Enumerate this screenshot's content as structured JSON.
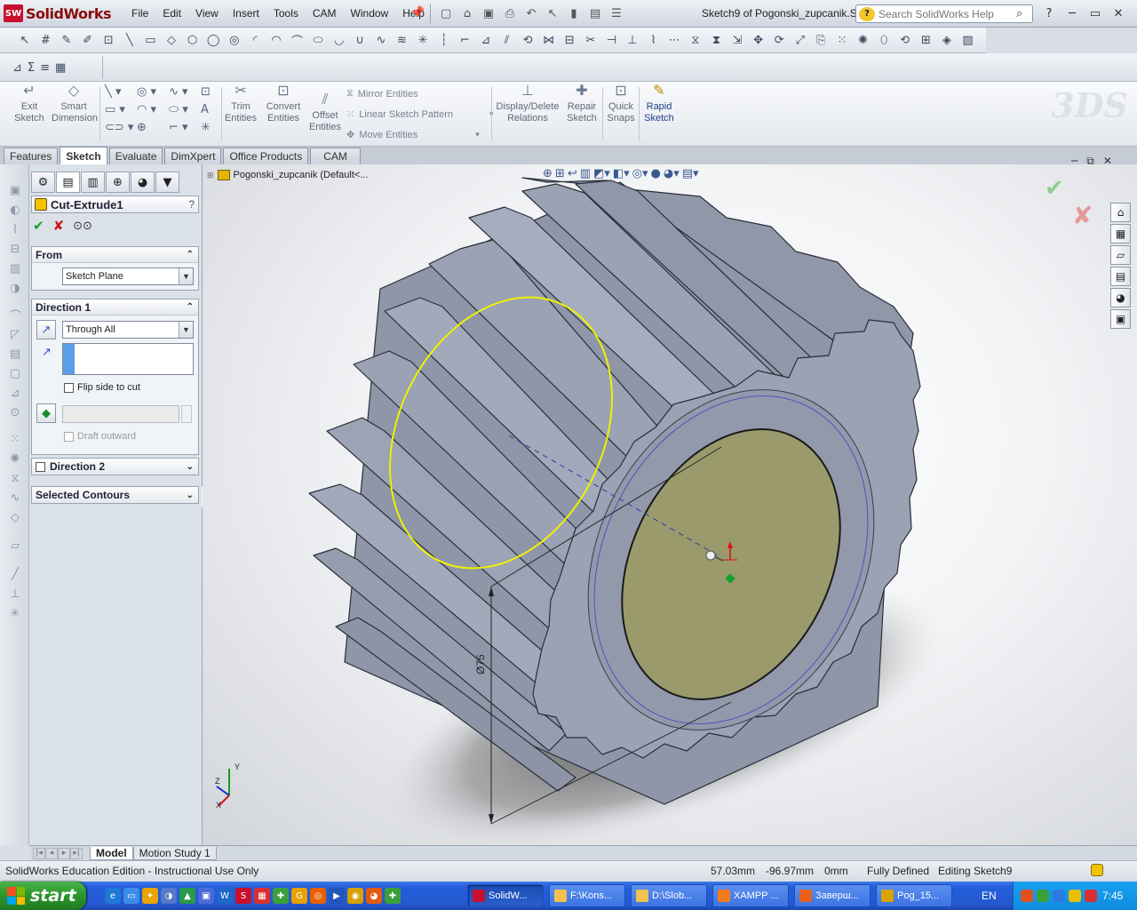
{
  "app": {
    "name": "SolidWorks",
    "logo_badge": "SW",
    "document_title": "Sketch9 of Pogonski_zupcanik.S...",
    "menus": [
      "File",
      "Edit",
      "View",
      "Insert",
      "Tools",
      "CAM",
      "Window",
      "Help"
    ],
    "help_search_placeholder": "Search SolidWorks Help",
    "help_glyph": "?"
  },
  "command_manager": {
    "buttons": {
      "exit_sketch": "Exit Sketch",
      "smart_dimension": "Smart Dimension",
      "trim_entities": "Trim Entities",
      "convert_entities": "Convert Entities",
      "offset_entities": "Offset Entities",
      "display_delete_relations": "Display/Delete Relations",
      "repair_sketch": "Repair Sketch",
      "quick_snaps": "Quick Snaps",
      "rapid_sketch": "Rapid Sketch"
    },
    "list": [
      "Mirror Entities",
      "Linear Sketch Pattern",
      "Move Entities"
    ],
    "tabs": [
      "Features",
      "Sketch",
      "Evaluate",
      "DimXpert",
      "Office Products",
      "CAM"
    ],
    "active_tab": "Sketch"
  },
  "property_manager": {
    "title": "Cut-Extrude1",
    "from": {
      "label": "From",
      "value": "Sketch Plane"
    },
    "direction1": {
      "label": "Direction 1",
      "end_condition": "Through All",
      "flip_side_label": "Flip side to cut",
      "draft_label": "Draft outward"
    },
    "direction2": {
      "label": "Direction 2"
    },
    "selected_contours": {
      "label": "Selected Contours"
    }
  },
  "feature_tree": {
    "root_label": "Pogonski_zupcanik  (Default<..."
  },
  "bottom_tabs": [
    "Model",
    "Motion Study 1"
  ],
  "graphics": {
    "dimension_label": "Ø75",
    "triad": {
      "x": "X",
      "y": "Y",
      "z": "Z"
    }
  },
  "status_bar": {
    "edition": "SolidWorks Education Edition - Instructional Use Only",
    "x": "57.03mm",
    "y": "-96.97mm",
    "z": "0mm",
    "state": "Fully Defined",
    "editing": "Editing Sketch9"
  },
  "taskbar": {
    "start_label": "start",
    "tasks": [
      {
        "label": "SolidW...",
        "color": "#c8102e",
        "active": true
      },
      {
        "label": "F:\\Kons...",
        "color": "#f2c14e",
        "active": false
      },
      {
        "label": "D:\\Slob...",
        "color": "#f2c14e",
        "active": false
      },
      {
        "label": "XAMPP ...",
        "color": "#f47a20",
        "active": false
      },
      {
        "label": "Заверш...",
        "color": "#e8601c",
        "active": false
      },
      {
        "label": "Pog_15...",
        "color": "#d9a400",
        "active": false
      }
    ],
    "language": "EN",
    "clock": "7:45"
  },
  "colors": {
    "gear_body": "#8e96a8",
    "gear_face": "#9aa2b4",
    "bore": "#9a9a6c",
    "sketch_circle": "#f0f000",
    "ok_check": "#1f9d2b",
    "cancel_x": "#c81515"
  }
}
